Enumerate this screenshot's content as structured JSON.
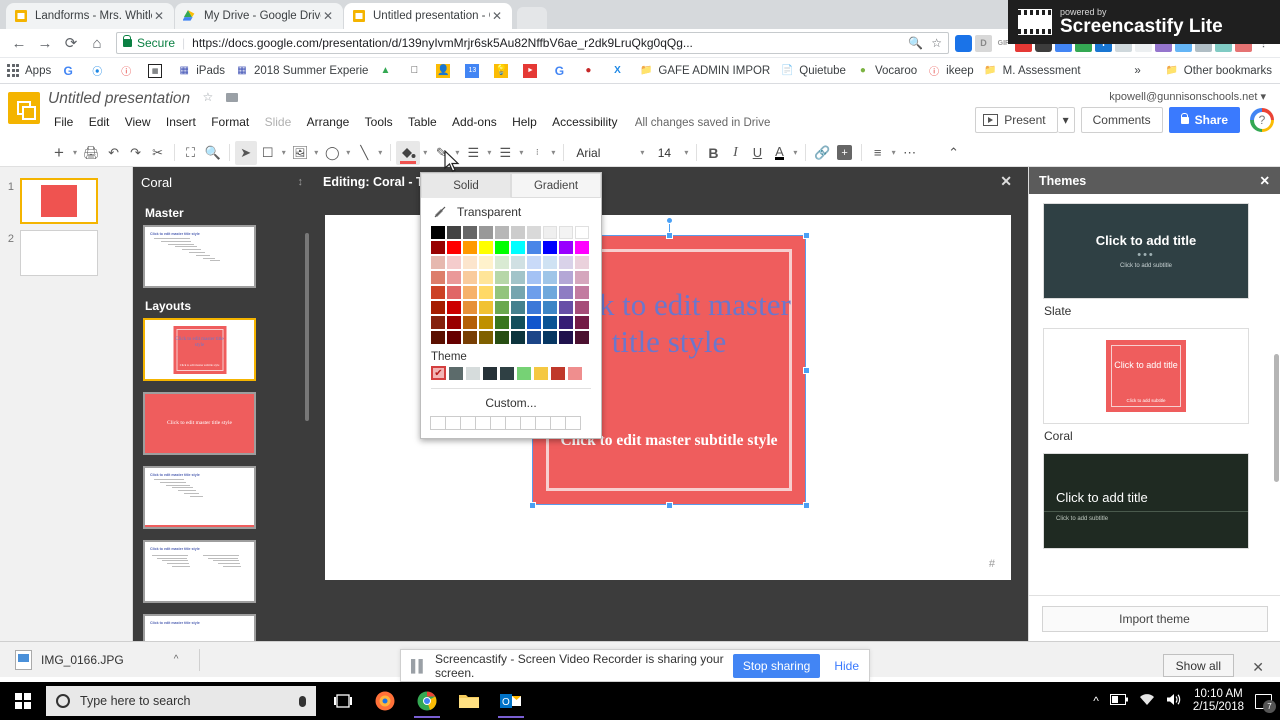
{
  "browser": {
    "tabs": [
      {
        "title": "Landforms - Mrs. Whitley",
        "favicon": "slides-icon",
        "active": false
      },
      {
        "title": "My Drive - Google Drive",
        "favicon": "drive-icon",
        "active": false
      },
      {
        "title": "Untitled presentation - G",
        "favicon": "slides-icon",
        "active": true
      }
    ],
    "nav": {
      "back": "←",
      "forward": "→",
      "reload": "⟳",
      "home": "⌂"
    },
    "address": {
      "secure_label": "Secure",
      "url_bold": "https://docs.google.com/presentation/d/139nyIvmMrjr6sk5Au82NffbV6ae_r2dk9LruQkg0qQg...",
      "zoom_icon": "search-icon",
      "star_icon": "star-icon"
    },
    "bookmarks": [
      {
        "label": "Apps",
        "icon": "apps-grid-icon"
      },
      {
        "label": "",
        "icon": "google-icon"
      },
      {
        "label": "",
        "icon": "blue-swirl-icon"
      },
      {
        "label": "",
        "icon": "info-icon"
      },
      {
        "label": "",
        "icon": "qr-icon"
      },
      {
        "label": "iPads",
        "icon": "window-icon"
      },
      {
        "label": "2018 Summer Experie",
        "icon": "window-icon"
      },
      {
        "label": "",
        "icon": "drive-icon"
      },
      {
        "label": "",
        "icon": "apple-icon"
      },
      {
        "label": "",
        "icon": "contacts-icon"
      },
      {
        "label": "",
        "icon": "calendar-icon"
      },
      {
        "label": "",
        "icon": "keep-icon"
      },
      {
        "label": "",
        "icon": "youtube-icon"
      },
      {
        "label": "",
        "icon": "google-icon"
      },
      {
        "label": "",
        "icon": "maps-pin-icon"
      },
      {
        "label": "",
        "icon": "excel-icon"
      },
      {
        "label": "GAFE ADMIN IMPOR",
        "icon": "folder-icon"
      },
      {
        "label": "Quietube",
        "icon": "page-icon"
      },
      {
        "label": "Vocaroo",
        "icon": "frog-icon"
      },
      {
        "label": "ikeep",
        "icon": "info-icon"
      },
      {
        "label": "M. Assessment",
        "icon": "folder-icon"
      }
    ],
    "overflow_label": "»",
    "other_bookmarks": "Other bookmarks"
  },
  "slides": {
    "doc_title": "Untitled presentation",
    "menu": [
      "File",
      "Edit",
      "View",
      "Insert",
      "Format",
      "Slide",
      "Arrange",
      "Tools",
      "Table",
      "Add-ons",
      "Help",
      "Accessibility"
    ],
    "disabled_menu": "Slide",
    "save_status": "All changes saved in Drive",
    "account": "kpowell@gunnisonschools.net",
    "present_label": "Present",
    "comments_label": "Comments",
    "share_label": "Share",
    "help_label": "?",
    "toolbar": {
      "font_family": "Arial",
      "font_size": "14",
      "bold": "B",
      "italic": "I",
      "underline": "U",
      "text_color": "A",
      "fill_color_swatch": "#ef5350"
    }
  },
  "slide_panel": {
    "slides": [
      {
        "number": "1",
        "selected": true
      },
      {
        "number": "2",
        "selected": false
      }
    ]
  },
  "master_panel": {
    "theme_name": "Coral",
    "master_label": "Master",
    "layouts_label": "Layouts",
    "master_title_text": "Click to edit master title style",
    "layout_titles": [
      "Click to edit master title style",
      "Click to edit master title style",
      "Click to edit master title style",
      "Click to edit master title style",
      "Click to edit master title style"
    ]
  },
  "canvas": {
    "edit_label": "Editing: Coral - Title",
    "close_icon": "close-icon",
    "title_text": "Click to edit master title style",
    "subtitle_text": "Click to edit master subtitle style",
    "page_placeholder": "#",
    "box_color": "#ef5d5d"
  },
  "color_picker": {
    "tabs": [
      "Solid",
      "Gradient"
    ],
    "active_tab": "Solid",
    "transparent_label": "Transparent",
    "theme_label": "Theme",
    "custom_label": "Custom...",
    "grid": [
      [
        "#000000",
        "#434343",
        "#666666",
        "#999999",
        "#b7b7b7",
        "#cccccc",
        "#d9d9d9",
        "#efefef",
        "#f3f3f3",
        "#ffffff"
      ],
      [
        "#980000",
        "#ff0000",
        "#ff9900",
        "#ffff00",
        "#00ff00",
        "#00ffff",
        "#4a86e8",
        "#0000ff",
        "#9900ff",
        "#ff00ff"
      ],
      [
        "#e6b8af",
        "#f4cccc",
        "#fce5cd",
        "#fff2cc",
        "#d9ead3",
        "#d0e0e3",
        "#c9daf8",
        "#cfe2f3",
        "#d9d2e9",
        "#ead1dc"
      ],
      [
        "#dd7e6b",
        "#ea9999",
        "#f9cb9c",
        "#ffe599",
        "#b6d7a8",
        "#a2c4c9",
        "#a4c2f4",
        "#9fc5e8",
        "#b4a7d6",
        "#d5a6bd"
      ],
      [
        "#cc4125",
        "#e06666",
        "#f6b26b",
        "#ffd966",
        "#93c47d",
        "#76a5af",
        "#6d9eeb",
        "#6fa8dc",
        "#8e7cc3",
        "#c27ba0"
      ],
      [
        "#a61c00",
        "#cc0000",
        "#e69138",
        "#f1c232",
        "#6aa84f",
        "#45818e",
        "#3c78d8",
        "#3d85c6",
        "#674ea7",
        "#a64d79"
      ],
      [
        "#85200c",
        "#990000",
        "#b45f06",
        "#bf9000",
        "#38761d",
        "#134f5c",
        "#1155cc",
        "#0b5394",
        "#351c75",
        "#741b47"
      ],
      [
        "#5b0f00",
        "#660000",
        "#783f04",
        "#7f6000",
        "#274e13",
        "#0c343d",
        "#1c4587",
        "#073763",
        "#20124d",
        "#4c1130"
      ]
    ],
    "theme_colors": [
      "#5c6b6b",
      "#d6dcdc",
      "#263238",
      "#2f4044",
      "#76d275",
      "#f5c842",
      "#c0392b",
      "#ef8e8e"
    ],
    "selected_theme_swatch": "#ef5d5d",
    "custom_slots": 10
  },
  "themes_panel": {
    "title": "Themes",
    "close_icon": "close-icon",
    "themes": [
      {
        "name": "Slate",
        "title_text": "Click to add title",
        "subtitle_text": "Click to add subtitle",
        "bg": "#2f4044"
      },
      {
        "name": "Coral",
        "title_text": "Click to add title",
        "subtitle_text": "Click to add subtitle",
        "bg": "#ffffff"
      },
      {
        "name": "",
        "title_text": "Click to add title",
        "subtitle_text": "Click to add subtitle",
        "bg": "#1f2a22"
      }
    ],
    "import_label": "Import theme"
  },
  "downloads": {
    "file_name": "IMG_0166.JPG",
    "caret": "⌃",
    "show_all": "Show all",
    "close_icon": "close-icon"
  },
  "screen_share": {
    "message": "Screencastify - Screen Video Recorder is sharing your screen.",
    "stop_label": "Stop sharing",
    "hide_label": "Hide"
  },
  "watermark": {
    "powered_by": "powered by",
    "brand": "Screencastify Lite"
  },
  "taskbar": {
    "search_placeholder": "Type here to search",
    "apps": [
      "task-view-icon",
      "firefox-icon",
      "chrome-icon",
      "file-explorer-icon",
      "outlook-icon"
    ],
    "time": "10:10 AM",
    "date": "2/15/2018",
    "notification_count": "7"
  }
}
